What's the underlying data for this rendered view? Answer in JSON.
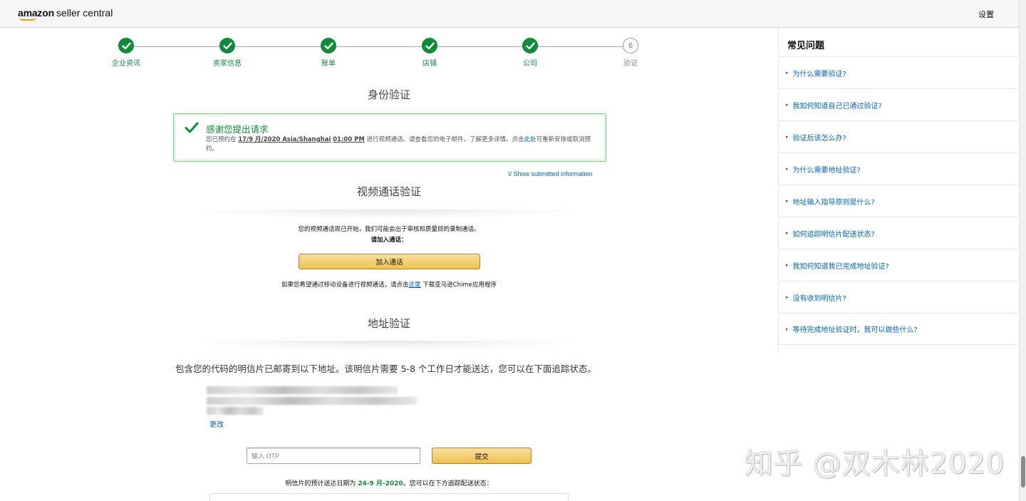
{
  "header": {
    "logo_amazon": "amazon",
    "logo_product": "seller central",
    "settings_label": "设置"
  },
  "steps": [
    {
      "label": "企业资讯",
      "state": "done"
    },
    {
      "label": "卖家信息",
      "state": "done"
    },
    {
      "label": "账单",
      "state": "done"
    },
    {
      "label": "店铺",
      "state": "done"
    },
    {
      "label": "公司",
      "state": "done"
    },
    {
      "label": "验证",
      "state": "pending",
      "number": "6"
    }
  ],
  "identity": {
    "title": "身份验证",
    "alert_title": "感谢您提出请求",
    "alert_text_before": "您已预约在 ",
    "alert_date": "17/9 月/2020 Asia/Shanghai",
    "alert_time": "01:00 PM",
    "alert_text_middle": " 进行视频通话。请查看您的电子邮件，了解更多详情。点击",
    "alert_link": "此处",
    "alert_text_after": "可重新安排或取消预约。",
    "show_info_label": "\\/ Show submitted information"
  },
  "video": {
    "title": "视频通话验证",
    "line1": "您的视频通话现已开始，我们可能会出于审核和质量目的录制通话。",
    "line2": "请加入通话：",
    "join_button": "加入通话",
    "mobile_before": "如果您希望通过移动设备进行视频通话，请点击",
    "mobile_link": "这里",
    "mobile_after": " 下载亚马逊Chime应用程序"
  },
  "address": {
    "title": "地址验证",
    "description": "包含您的代码的明信片已邮寄到以下地址。该明信片需要 5-8 个工作日才能送达，您可以在下面追踪状态。",
    "change_link": "更改",
    "otp_placeholder": "输入 OTP",
    "submit_button": "提交",
    "delivery_before": "明信片的预计送达日期为 ",
    "delivery_date": "24-9 月-2020",
    "delivery_after": "。您可以在下方追踪配送状态："
  },
  "sidebar": {
    "title": "常见问题",
    "items": [
      "为什么需要验证?",
      "我如何知道自己已通过验证?",
      "验证后该怎么办?",
      "为什么需要地址验证?",
      "地址输入指导原则是什么?",
      "如何追踪明信片配送状态?",
      "我如何知道我已完成地址验证?",
      "没有收到明信片?",
      "等待完成地址验证时，我可以做些什么?"
    ]
  },
  "watermark": "知乎 @双木林2020",
  "colors": {
    "success_green": "#118a3e",
    "link_blue": "#0066c0",
    "button_yellow": "#f0c14b",
    "brand_orange": "#ff9900"
  }
}
